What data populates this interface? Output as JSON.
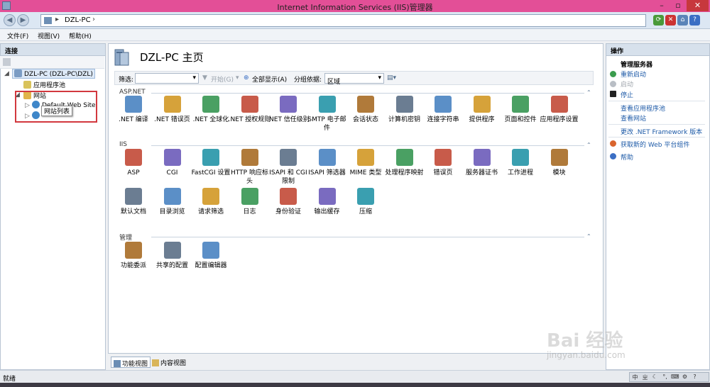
{
  "window": {
    "title": "Internet Information Services (IIS)管理器",
    "min_label": "–",
    "max_label": "▫",
    "close_label": "✕"
  },
  "address": {
    "segment": "DZL-PC",
    "chevron1": "▸",
    "chevron2": "›"
  },
  "menu": {
    "file": "文件(F)",
    "view": "视图(V)",
    "help": "帮助(H)"
  },
  "connections": {
    "header": "连接",
    "tree": {
      "server": "DZL-PC (DZL-PC\\DZL)",
      "app_pools": "应用程序池",
      "sites": "网站",
      "default_site": "Default Web Site",
      "tooltip": "网站列表"
    }
  },
  "main": {
    "title": "DZL-PC 主页",
    "filter": {
      "label": "筛选:",
      "start": "开始(G)",
      "show_all": "全部显示(A)",
      "group_by": "分组依据:",
      "group_value": "区域"
    },
    "groups": [
      {
        "name": "ASP.NET",
        "features": [
          {
            "label": ".NET 编译",
            "icon": "net-compilation-icon"
          },
          {
            "label": ".NET 错误页",
            "icon": "net-error-pages-icon"
          },
          {
            "label": ".NET 全球化",
            "icon": "net-globalization-icon"
          },
          {
            "label": ".NET 授权规则",
            "icon": "net-authorization-icon"
          },
          {
            "label": ".NET 信任级别",
            "icon": "net-trust-levels-icon"
          },
          {
            "label": "SMTP 电子邮件",
            "icon": "smtp-email-icon"
          },
          {
            "label": "会话状态",
            "icon": "session-state-icon"
          },
          {
            "label": "计算机密钥",
            "icon": "machine-key-icon"
          },
          {
            "label": "连接字符串",
            "icon": "connection-strings-icon"
          },
          {
            "label": "提供程序",
            "icon": "providers-icon"
          },
          {
            "label": "页面和控件",
            "icon": "pages-controls-icon"
          },
          {
            "label": "应用程序设置",
            "icon": "app-settings-icon"
          }
        ]
      },
      {
        "name": "IIS",
        "features": [
          {
            "label": "ASP",
            "icon": "asp-icon"
          },
          {
            "label": "CGI",
            "icon": "cgi-icon"
          },
          {
            "label": "FastCGI 设置",
            "icon": "fastcgi-icon"
          },
          {
            "label": "HTTP 响应标头",
            "icon": "http-headers-icon"
          },
          {
            "label": "ISAPI 和 CGI 限制",
            "icon": "isapi-cgi-icon"
          },
          {
            "label": "ISAPI 筛选器",
            "icon": "isapi-filters-icon"
          },
          {
            "label": "MIME 类型",
            "icon": "mime-types-icon"
          },
          {
            "label": "处理程序映射",
            "icon": "handler-mappings-icon"
          },
          {
            "label": "错误页",
            "icon": "error-pages-icon"
          },
          {
            "label": "服务器证书",
            "icon": "server-certificates-icon"
          },
          {
            "label": "工作进程",
            "icon": "worker-processes-icon"
          },
          {
            "label": "模块",
            "icon": "modules-icon"
          },
          {
            "label": "默认文档",
            "icon": "default-document-icon"
          },
          {
            "label": "目录浏览",
            "icon": "directory-browsing-icon"
          },
          {
            "label": "请求筛选",
            "icon": "request-filtering-icon"
          },
          {
            "label": "日志",
            "icon": "logging-icon"
          },
          {
            "label": "身份验证",
            "icon": "authentication-icon"
          },
          {
            "label": "输出缓存",
            "icon": "output-caching-icon"
          },
          {
            "label": "压缩",
            "icon": "compression-icon"
          }
        ]
      },
      {
        "name": "管理",
        "features": [
          {
            "label": "功能委派",
            "icon": "feature-delegation-icon"
          },
          {
            "label": "共享的配置",
            "icon": "shared-config-icon"
          },
          {
            "label": "配置编辑器",
            "icon": "config-editor-icon"
          }
        ]
      }
    ],
    "view_tabs": {
      "features": "功能视图",
      "content": "内容视图"
    }
  },
  "actions": {
    "header": "操作",
    "manage_server": "管理服务器",
    "restart": "重新启动",
    "start": "启动",
    "stop": "停止",
    "view_app_pools": "查看应用程序池",
    "view_sites": "查看网站",
    "change_framework": "更改 .NET Framework 版本",
    "get_web_components": "获取新的 Web 平台组件",
    "help": "帮助"
  },
  "status": {
    "text": "就绪"
  },
  "watermark": {
    "brand": "Bai 经验",
    "url": "jingyan.baidu.com"
  },
  "colors": {
    "titlebar": "#e34f97",
    "close": "#c7383d",
    "link": "#1d5aa7",
    "highlight": "#d2383e"
  }
}
